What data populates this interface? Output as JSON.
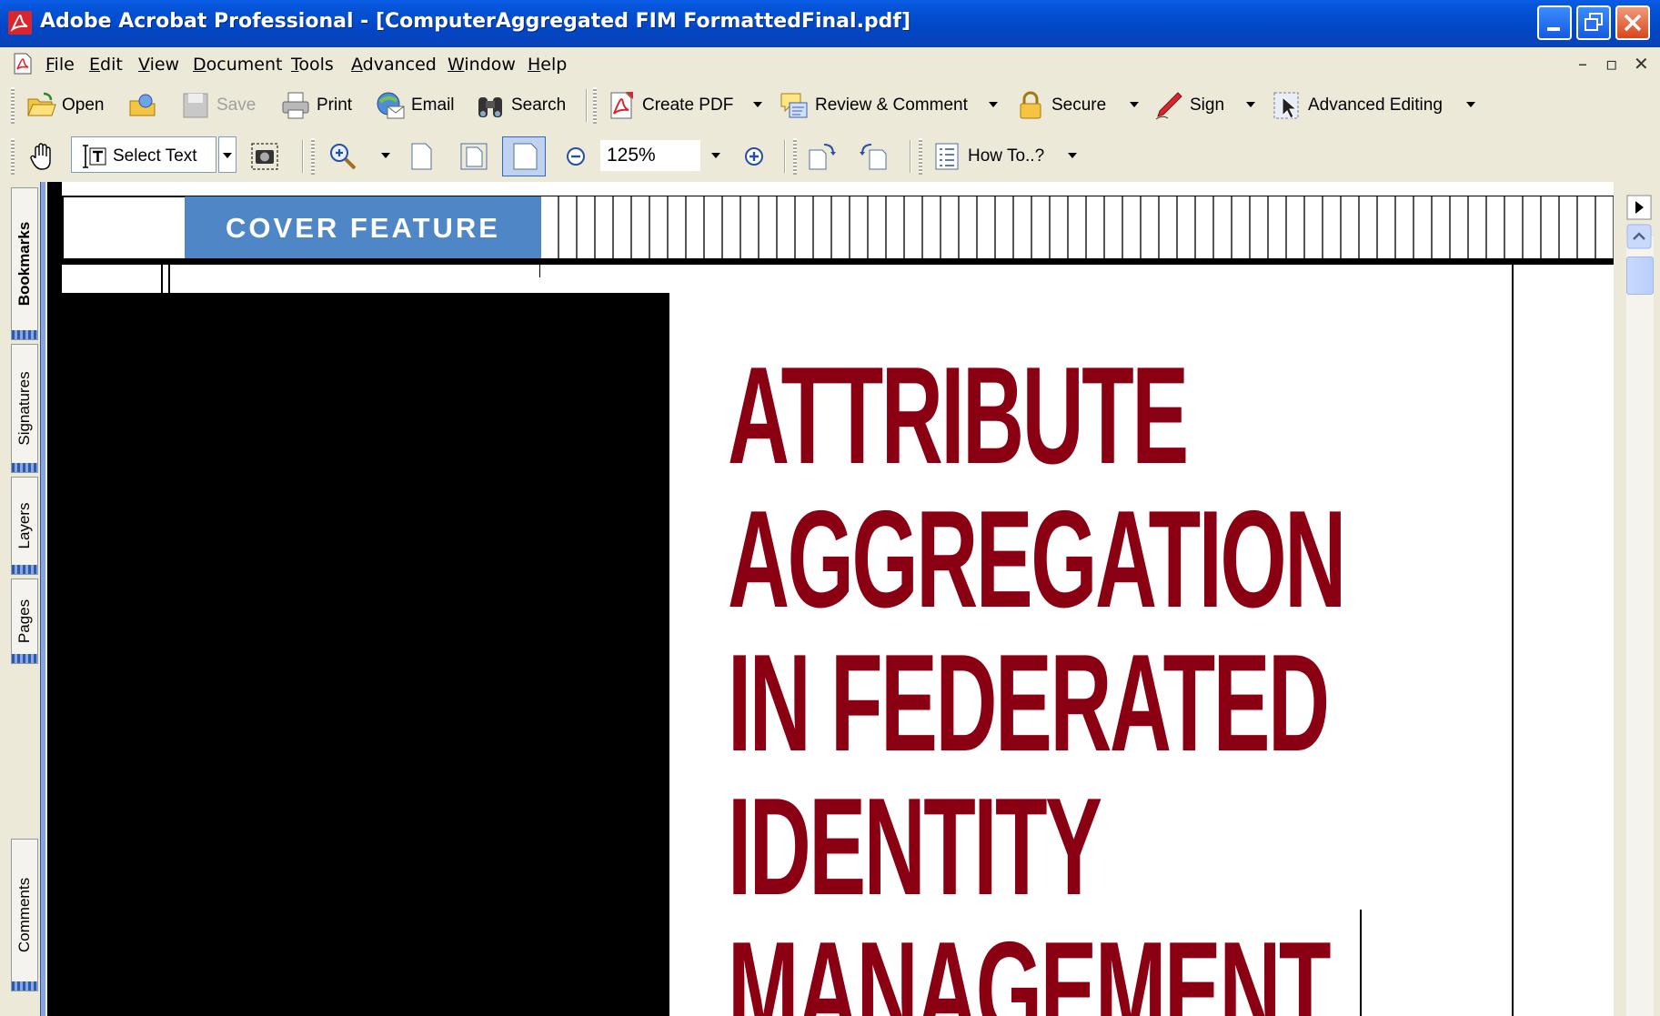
{
  "window": {
    "title": "Adobe Acrobat Professional - [ComputerAggregated FIM FormattedFinal.pdf]"
  },
  "menu": {
    "items": [
      {
        "label": "File",
        "ul": "F"
      },
      {
        "label": "Edit",
        "ul": "E"
      },
      {
        "label": "View",
        "ul": "V"
      },
      {
        "label": "Document",
        "ul": "D"
      },
      {
        "label": "Tools",
        "ul": "T"
      },
      {
        "label": "Advanced",
        "ul": "A"
      },
      {
        "label": "Window",
        "ul": "W"
      },
      {
        "label": "Help",
        "ul": "H"
      }
    ]
  },
  "toolbar1": {
    "open": "Open",
    "save": "Save",
    "print": "Print",
    "email": "Email",
    "search": "Search",
    "create_pdf": "Create PDF",
    "review_comment": "Review & Comment",
    "secure": "Secure",
    "sign": "Sign",
    "advanced_editing": "Advanced Editing"
  },
  "toolbar2": {
    "select_text": "Select Text",
    "zoom_value": "125%",
    "how_to": "How To..?"
  },
  "side_tabs": {
    "bookmarks": "Bookmarks",
    "signatures": "Signatures",
    "layers": "Layers",
    "pages": "Pages",
    "comments": "Comments"
  },
  "document": {
    "section_label": "COVER FEATURE",
    "headline": [
      "ATTRIBUTE",
      "AGGREGATION",
      "IN FEDERATED",
      "IDENTITY",
      "MANAGEMENT"
    ]
  },
  "colors": {
    "titlebar": "#0553d6",
    "cover_band": "#4f86c6",
    "headline": "#8a0012"
  }
}
